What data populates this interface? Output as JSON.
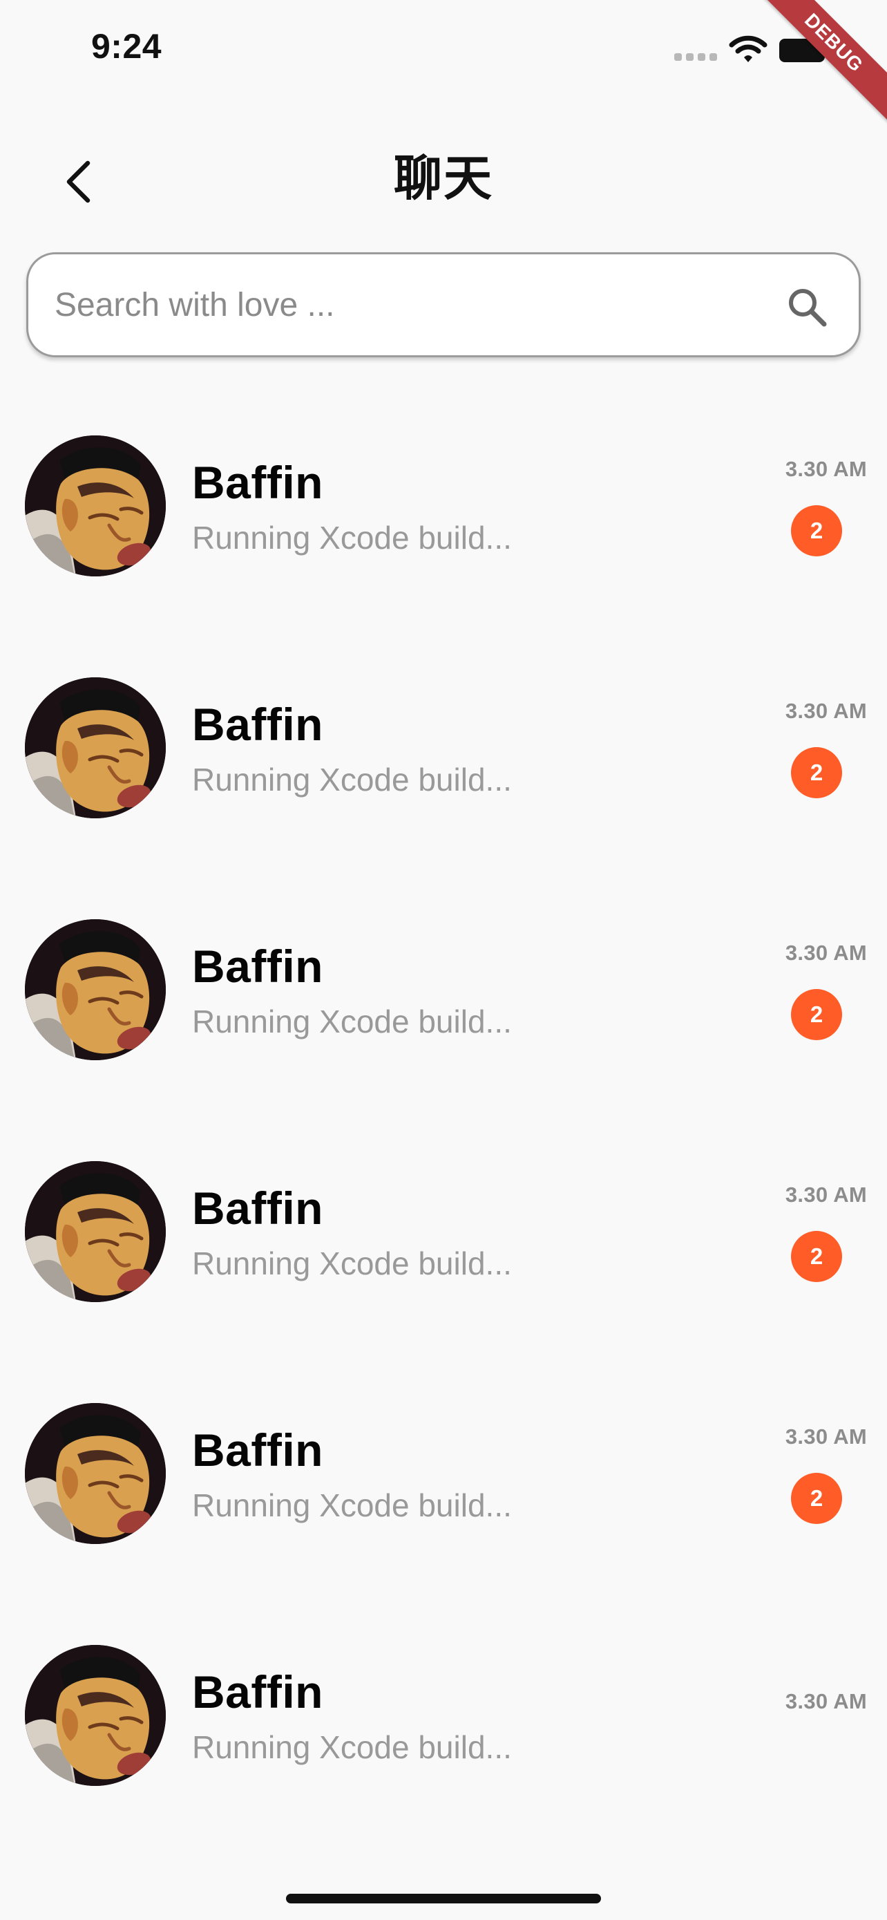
{
  "status_bar": {
    "time": "9:24",
    "icons": [
      "cellular-signal-icon",
      "wifi-icon",
      "battery-icon"
    ]
  },
  "debug_banner": "DEBUG",
  "header": {
    "back_icon": "chevron-left-icon",
    "title": "聊天"
  },
  "search": {
    "placeholder": "Search with love ...",
    "value": "",
    "icon": "search-icon"
  },
  "colors": {
    "background": "#f9f9f9",
    "badge": "#ff5c27",
    "muted_text": "#999999"
  },
  "chats": [
    {
      "name": "Baffin",
      "message": "Running Xcode build...",
      "time": "3.30 AM",
      "badge": "2"
    },
    {
      "name": "Baffin",
      "message": "Running Xcode build...",
      "time": "3.30 AM",
      "badge": "2"
    },
    {
      "name": "Baffin",
      "message": "Running Xcode build...",
      "time": "3.30 AM",
      "badge": "2"
    },
    {
      "name": "Baffin",
      "message": "Running Xcode build...",
      "time": "3.30 AM",
      "badge": "2"
    },
    {
      "name": "Baffin",
      "message": "Running Xcode build...",
      "time": "3.30 AM",
      "badge": "2"
    },
    {
      "name": "Baffin",
      "message": "Running Xcode build...",
      "time": "3.30 AM",
      "badge": ""
    }
  ]
}
